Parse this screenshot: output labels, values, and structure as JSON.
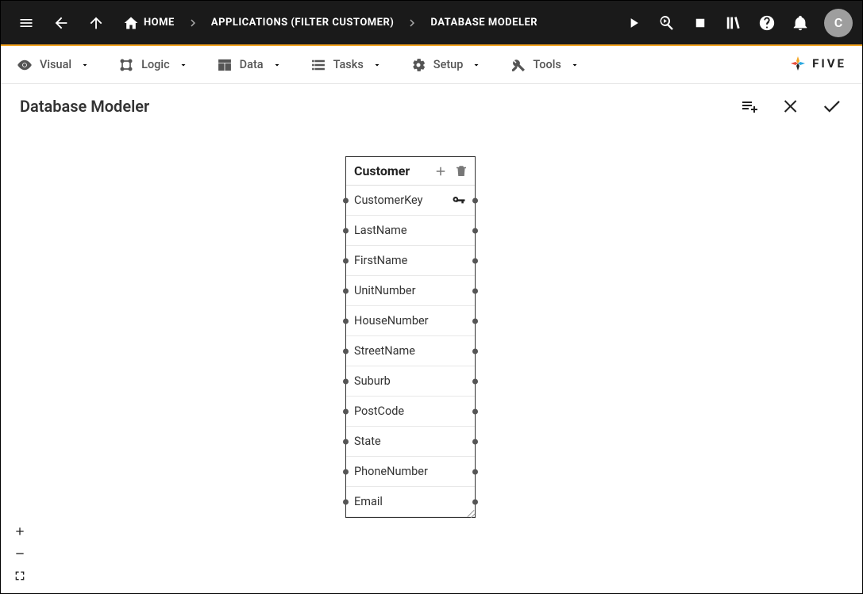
{
  "topbar": {
    "breadcrumbs": [
      {
        "label": "HOME"
      },
      {
        "label": "APPLICATIONS (FILTER CUSTOMER)"
      },
      {
        "label": "DATABASE MODELER"
      }
    ],
    "avatar_initial": "C"
  },
  "menubar": {
    "items": [
      {
        "label": "Visual"
      },
      {
        "label": "Logic"
      },
      {
        "label": "Data"
      },
      {
        "label": "Tasks"
      },
      {
        "label": "Setup"
      },
      {
        "label": "Tools"
      }
    ],
    "logo_text": "FIVE"
  },
  "title": "Database Modeler",
  "table": {
    "name": "Customer",
    "fields": [
      {
        "name": "CustomerKey",
        "pk": true
      },
      {
        "name": "LastName",
        "pk": false
      },
      {
        "name": "FirstName",
        "pk": false
      },
      {
        "name": "UnitNumber",
        "pk": false
      },
      {
        "name": "HouseNumber",
        "pk": false
      },
      {
        "name": "StreetName",
        "pk": false
      },
      {
        "name": "Suburb",
        "pk": false
      },
      {
        "name": "PostCode",
        "pk": false
      },
      {
        "name": "State",
        "pk": false
      },
      {
        "name": "PhoneNumber",
        "pk": false
      },
      {
        "name": "Email",
        "pk": false
      }
    ]
  }
}
